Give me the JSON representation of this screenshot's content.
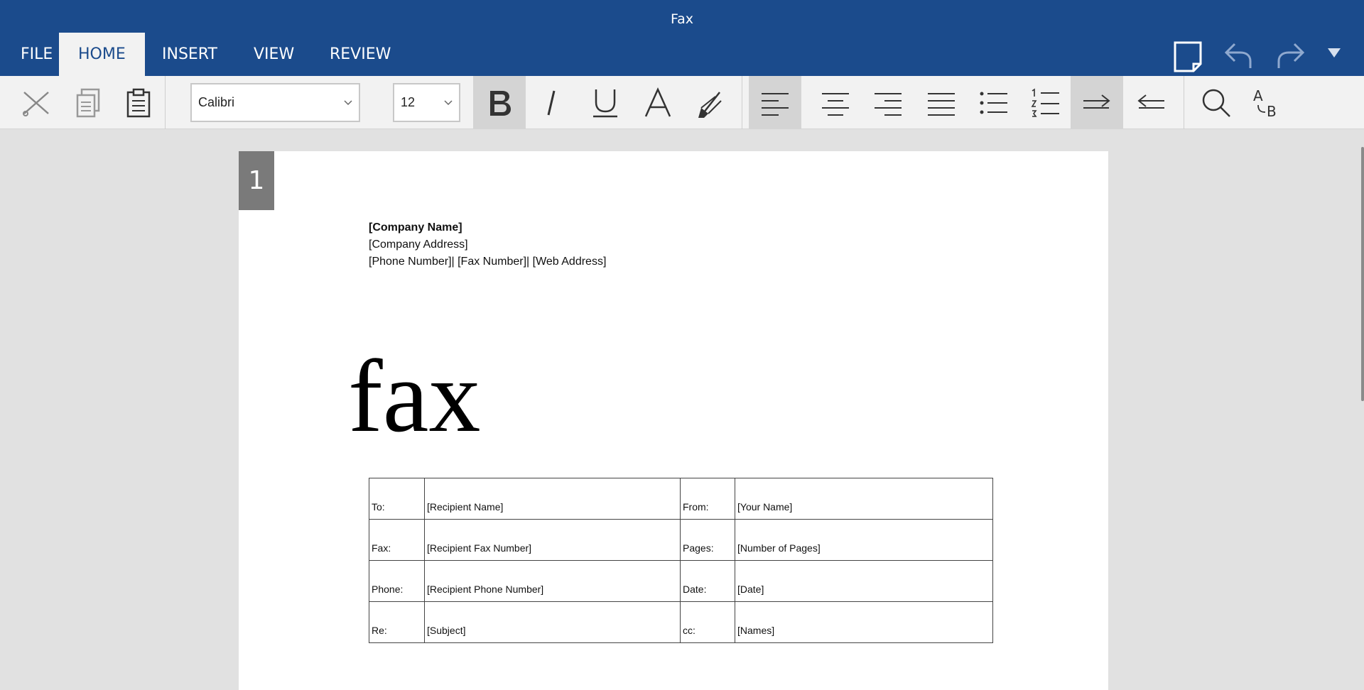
{
  "window": {
    "title": "Fax"
  },
  "tabs": [
    "FILE",
    "HOME",
    "INSERT",
    "VIEW",
    "REVIEW"
  ],
  "ribbon": {
    "font_name": "Calibri",
    "font_size": "12"
  },
  "page_number": "1",
  "document": {
    "company_name": "[Company Name]",
    "company_address": "[Company Address]",
    "contact_line": "[Phone Number]| [Fax Number]| [Web Address]",
    "big_title": "fax",
    "table": {
      "rows": [
        [
          "To:",
          "[Recipient Name]",
          "From:",
          "[Your Name]"
        ],
        [
          "Fax:",
          "[Recipient Fax Number]",
          "Pages:",
          "[Number of Pages]"
        ],
        [
          "Phone:",
          "[Recipient Phone Number]",
          "Date:",
          "[Date]"
        ],
        [
          "Re:",
          "[Subject]",
          "cc:",
          "[Names]"
        ]
      ]
    }
  },
  "colors": {
    "titlebar": "#1b4b8c",
    "ribbon": "#f2f2f2",
    "workspace": "#e1e1e1",
    "selected_button": "#d4d4d4"
  }
}
